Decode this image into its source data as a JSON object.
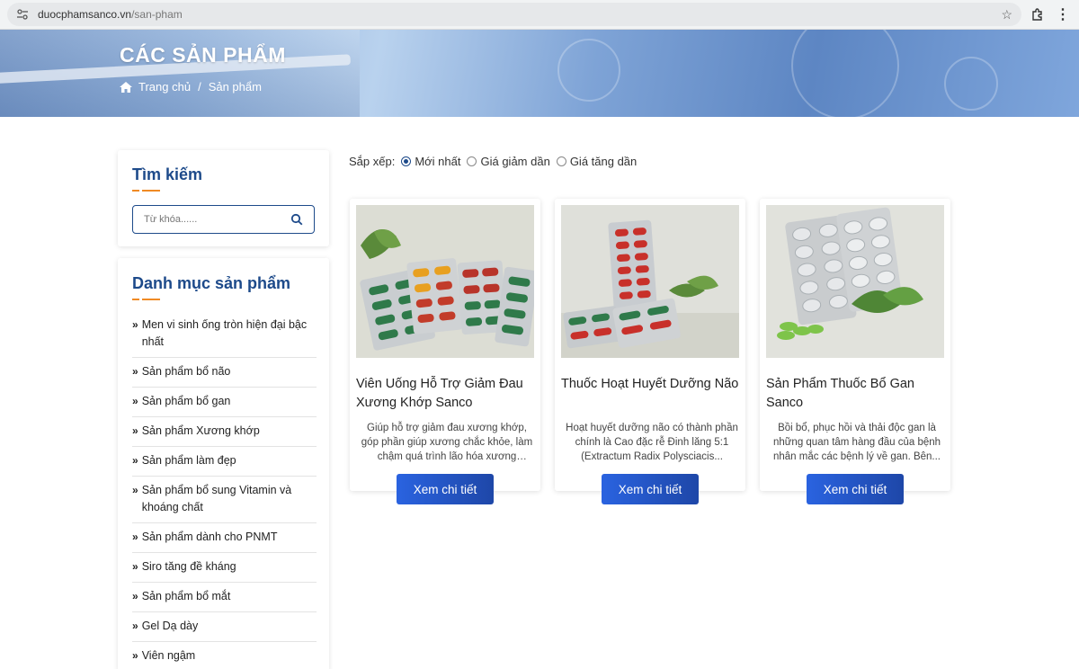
{
  "browser": {
    "url_host": "duocphamsanco.vn",
    "url_path": "/san-pham"
  },
  "banner": {
    "title": "CÁC SẢN PHẨM",
    "breadcrumb_home": "Trang chủ",
    "breadcrumb_sep": "/",
    "breadcrumb_current": "Sản phẩm"
  },
  "search": {
    "title": "Tìm kiếm",
    "placeholder": "Từ khóa......"
  },
  "categories": {
    "title": "Danh mục sản phẩm",
    "items": [
      "Men vi sinh ống tròn hiện đại bậc nhất",
      "Sản phẩm bổ não",
      "Sản phẩm bổ gan",
      "Sản phẩm Xương khớp",
      "Sản phẩm làm đẹp",
      "Sản phẩm bổ sung Vitamin và khoáng chất",
      "Sản phẩm dành cho PNMT",
      "Siro tăng đề kháng",
      "Sản phẩm bổ mắt",
      "Gel Dạ dày",
      "Viên ngậm"
    ]
  },
  "sort": {
    "label": "Sắp xếp:",
    "options": [
      "Mới nhất",
      "Giá giảm dần",
      "Giá tăng dần"
    ],
    "selected": "Mới nhất"
  },
  "products": [
    {
      "name": "Viên Uống Hỗ Trợ Giảm Đau Xương Khớp Sanco",
      "desc": "Giúp hỗ trợ giảm đau xương khớp, góp phần giúp xương chắc khỏe, làm chậm quá trình lão hóa xương khớp...",
      "button": "Xem chi tiết"
    },
    {
      "name": "Thuốc Hoạt Huyết Dưỡng Não",
      "desc": "Hoạt huyết dưỡng não có thành phần chính là Cao đặc rễ Đinh lăng 5:1 (Extractum Radix Polysciacis...",
      "button": "Xem chi tiết"
    },
    {
      "name": "Sản Phẩm Thuốc Bổ Gan Sanco",
      "desc": "Bồi bổ, phục hồi và thải độc gan là những quan tâm hàng đầu của bệnh nhân mắc các bệnh lý về gan. Bên...",
      "button": "Xem chi tiết"
    }
  ]
}
